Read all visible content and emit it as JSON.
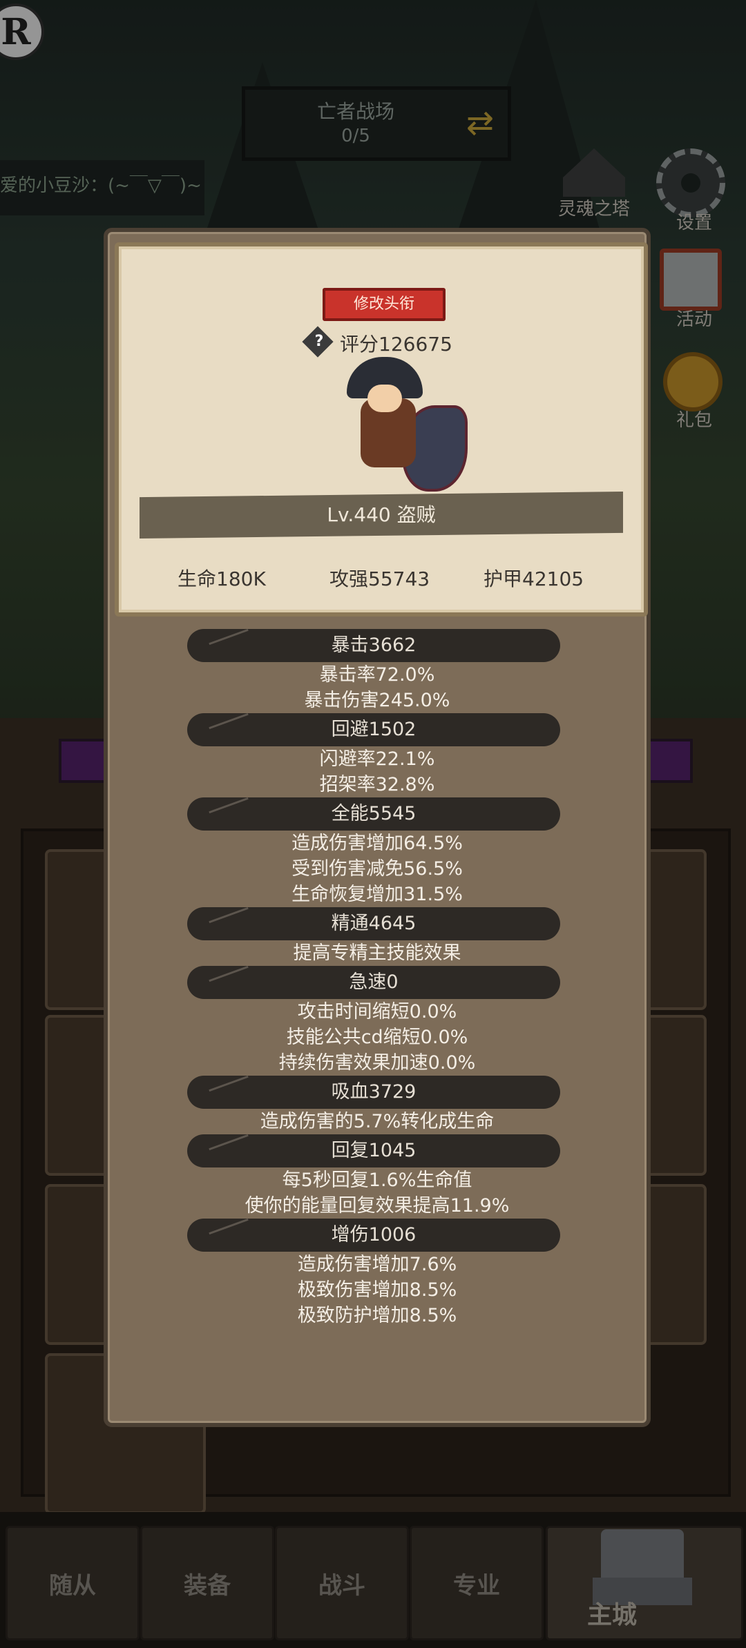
{
  "background": {
    "logo_letter": "R",
    "battlefield": {
      "title": "亡者战场",
      "count": "0/5"
    },
    "chat": "爱的小豆沙：(~￣▽￣)~",
    "side_buttons": {
      "soul_tower": "灵魂之塔",
      "settings": "设置",
      "activity": "活动",
      "gift": "礼包"
    },
    "bottom_nav": [
      "随从",
      "装备",
      "战斗",
      "专业"
    ],
    "main_city": "主城"
  },
  "profile": {
    "edit_title_button": "修改头衔",
    "score": "评分126675",
    "level_class": "Lv.440 盗贼",
    "life": "生命180K",
    "attack": "攻强55743",
    "armor": "护甲42105"
  },
  "stat_groups": [
    {
      "name": "暴击3662",
      "lines": [
        "暴击率72.0%",
        "暴击伤害245.0%"
      ]
    },
    {
      "name": "回避1502",
      "lines": [
        "闪避率22.1%",
        "招架率32.8%"
      ]
    },
    {
      "name": "全能5545",
      "lines": [
        "造成伤害增加64.5%",
        "受到伤害减免56.5%",
        "生命恢复增加31.5%"
      ]
    },
    {
      "name": "精通4645",
      "lines": [
        "提高专精主技能效果"
      ]
    },
    {
      "name": "急速0",
      "lines": [
        "攻击时间缩短0.0%",
        "技能公共cd缩短0.0%",
        "持续伤害效果加速0.0%"
      ]
    },
    {
      "name": "吸血3729",
      "lines": [
        "造成伤害的5.7%转化成生命"
      ]
    },
    {
      "name": "回复1045",
      "lines": [
        "每5秒回复1.6%生命值",
        "使你的能量回复效果提高11.9%"
      ]
    },
    {
      "name": "增伤1006",
      "lines": [
        "造成伤害增加7.6%",
        "极致伤害增加8.5%",
        "极致防护增加8.5%"
      ]
    }
  ]
}
